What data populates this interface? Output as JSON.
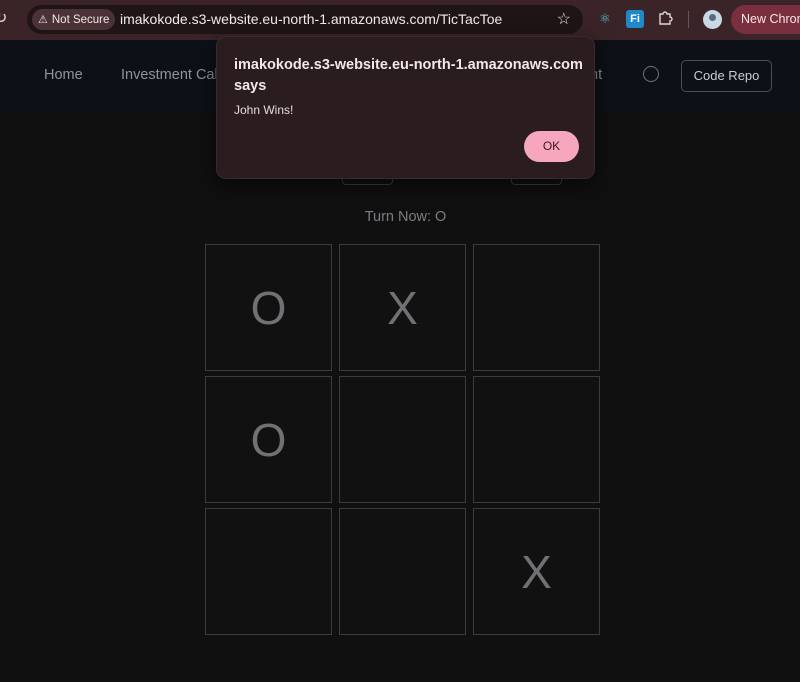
{
  "browser": {
    "security_chip": "Not Secure",
    "url": "imakokode.s3-website.eu-north-1.amazonaws.com/TicTacToe",
    "new_chrome_label": "New Chrom"
  },
  "nav": {
    "home": "Home",
    "investment": "Investment Calc",
    "tail_fragment": "nt",
    "code_repo": "Code Repo"
  },
  "game": {
    "turn_label": "Turn Now:",
    "turn_value": "O",
    "cells": [
      "O",
      "X",
      "",
      "O",
      "",
      "",
      "",
      "",
      "X"
    ]
  },
  "alert": {
    "title": "imakokode.s3-website.eu-north-1.amazonaws.com says",
    "message": "John Wins!",
    "ok_label": "OK"
  },
  "icons": {
    "reload": "reload-icon",
    "warning": "warning-icon",
    "star": "bookmark-star-icon",
    "react": "react-devtools-icon",
    "fi": "fi-extension-icon",
    "extensions": "puzzle-icon",
    "profile": "avatar",
    "dribbble": "dribbble-icon"
  },
  "colors": {
    "toolbar": "#3a2428",
    "page_bg": "#101010",
    "ok_button": "#f7a7bd"
  }
}
